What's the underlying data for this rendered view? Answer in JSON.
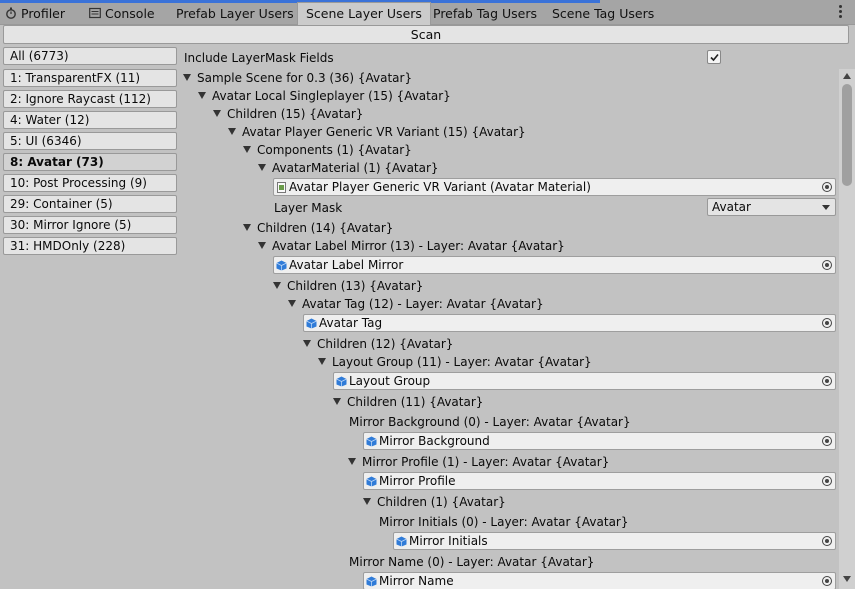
{
  "tabs": [
    {
      "label": "Profiler",
      "icon": "stopwatch-icon"
    },
    {
      "label": "Console",
      "icon": "console-icon"
    },
    {
      "label": "Prefab Layer Users"
    },
    {
      "label": "Scene Layer Users",
      "active": true
    },
    {
      "label": "Prefab Tag Users"
    },
    {
      "label": "Scene Tag Users"
    }
  ],
  "scan_label": "Scan",
  "layers": [
    {
      "label": "All (6773)"
    },
    {
      "label": "1: TransparentFX (11)"
    },
    {
      "label": "2: Ignore Raycast (112)"
    },
    {
      "label": "4: Water (12)"
    },
    {
      "label": "5: UI (6346)"
    },
    {
      "label": "8: Avatar (73)",
      "selected": true
    },
    {
      "label": "10: Post Processing (9)"
    },
    {
      "label": "29: Container (5)"
    },
    {
      "label": "30: Mirror Ignore (5)"
    },
    {
      "label": "31: HMDOnly (228)"
    }
  ],
  "include_layermask": {
    "label": "Include LayerMask Fields",
    "checked": true
  },
  "tree": {
    "n0": "Sample Scene for 0.3 (36) {Avatar}",
    "n1": "Avatar Local Singleplayer (15) {Avatar}",
    "n2": "Children (15) {Avatar}",
    "n3": "Avatar Player Generic VR Variant (15) {Avatar}",
    "n4": "Components (1) {Avatar}",
    "n5": "AvatarMaterial (1) {Avatar}",
    "f5": "Avatar Player Generic VR Variant (Avatar Material)",
    "layer_mask_label": "Layer Mask",
    "layer_mask_value": "Avatar",
    "n6": "Children (14) {Avatar}",
    "n7": "Avatar Label Mirror (13) - Layer: Avatar {Avatar}",
    "f7": "Avatar Label Mirror",
    "n8": "Children (13) {Avatar}",
    "n9": "Avatar Tag (12) - Layer: Avatar {Avatar}",
    "f9": "Avatar Tag",
    "n10": "Children (12) {Avatar}",
    "n11": "Layout Group (11) - Layer: Avatar {Avatar}",
    "f11": "Layout Group",
    "n12": "Children (11) {Avatar}",
    "n13": "Mirror Background (0) - Layer: Avatar {Avatar}",
    "f13": "Mirror Background",
    "n14": "Mirror Profile (1) - Layer: Avatar {Avatar}",
    "f14": "Mirror Profile",
    "n15": "Children (1) {Avatar}",
    "n16": "Mirror Initials (0) - Layer: Avatar {Avatar}",
    "f16": "Mirror Initials",
    "n17": "Mirror Name (0) - Layer: Avatar {Avatar}",
    "f17": "Mirror Name"
  },
  "colors": {
    "accent": "#3a72d8",
    "cube_icon": "#2f7bd8"
  }
}
